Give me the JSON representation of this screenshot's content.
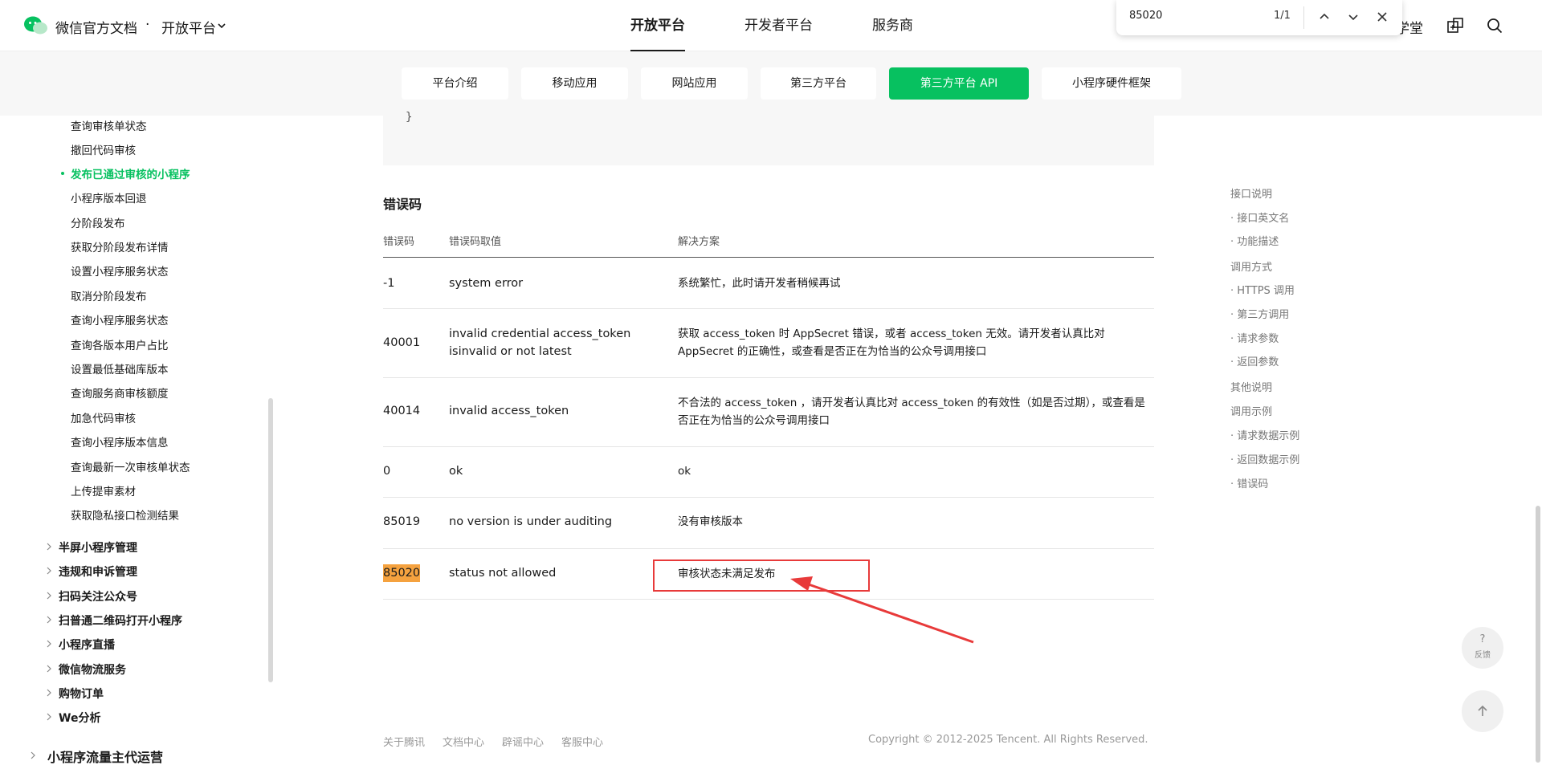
{
  "header": {
    "brand": "微信官方文档",
    "dot": "·",
    "platform": "开放平台",
    "nav": [
      "开放平台",
      "开发者平台",
      "服务商"
    ],
    "partial_link": "学堂"
  },
  "find": {
    "query": "85020",
    "count": "1/1"
  },
  "tabs": [
    "平台介绍",
    "移动应用",
    "网站应用",
    "第三方平台",
    "第三方平台 API",
    "小程序硬件框架"
  ],
  "sidebar": {
    "items": [
      "查询审核单状态",
      "撤回代码审核",
      "发布已通过审核的小程序",
      "小程序版本回退",
      "分阶段发布",
      "获取分阶段发布详情",
      "设置小程序服务状态",
      "取消分阶段发布",
      "查询小程序服务状态",
      "查询各版本用户占比",
      "设置最低基础库版本",
      "查询服务商审核额度",
      "加急代码审核",
      "查询小程序版本信息",
      "查询最新一次审核单状态",
      "上传提审素材",
      "获取隐私接口检测结果"
    ],
    "groups": [
      "半屏小程序管理",
      "违规和申诉管理",
      "扫码关注公众号",
      "扫普通二维码打开小程序",
      "小程序直播",
      "微信物流服务",
      "购物订单",
      "We分析"
    ],
    "bottom_group": "小程序流量主代运营"
  },
  "code_tail": "}",
  "error_section": {
    "title": "错误码",
    "headers": [
      "错误码",
      "错误码取值",
      "解决方案"
    ],
    "rows": [
      {
        "code": "-1",
        "value": "system error",
        "solution": "系统繁忙，此时请开发者稍候再试"
      },
      {
        "code": "40001",
        "value": "invalid credential  access_token isinvalid or not latest",
        "solution": "获取 access_token 时 AppSecret 错误，或者 access_token 无效。请开发者认真比对 AppSecret 的正确性，或查看是否正在为恰当的公众号调用接口"
      },
      {
        "code": "40014",
        "value": "invalid access_token",
        "solution": "不合法的 access_token ，请开发者认真比对 access_token 的有效性（如是否过期），或查看是否正在为恰当的公众号调用接口"
      },
      {
        "code": "0",
        "value": "ok",
        "solution": "ok"
      },
      {
        "code": "85019",
        "value": "no version is under auditing",
        "solution": "没有审核版本"
      },
      {
        "code": "85020",
        "value": "status not allowed",
        "solution": "审核状态未满足发布"
      }
    ]
  },
  "toc": [
    "接口说明",
    "· 接口英文名",
    "· 功能描述",
    "调用方式",
    "· HTTPS 调用",
    "· 第三方调用",
    "· 请求参数",
    "· 返回参数",
    "其他说明",
    "调用示例",
    "· 请求数据示例",
    "· 返回数据示例",
    "· 错误码"
  ],
  "footer": {
    "links": [
      "关于腾讯",
      "文档中心",
      "辟谣中心",
      "客服中心"
    ],
    "copyright": "Copyright © 2012-2025 Tencent. All Rights Reserved."
  },
  "feedback": {
    "q": "?",
    "label": "反馈"
  },
  "colors": {
    "accent": "#07c160",
    "highlight": "#f5a23f",
    "annotation": "#e83a3a"
  }
}
